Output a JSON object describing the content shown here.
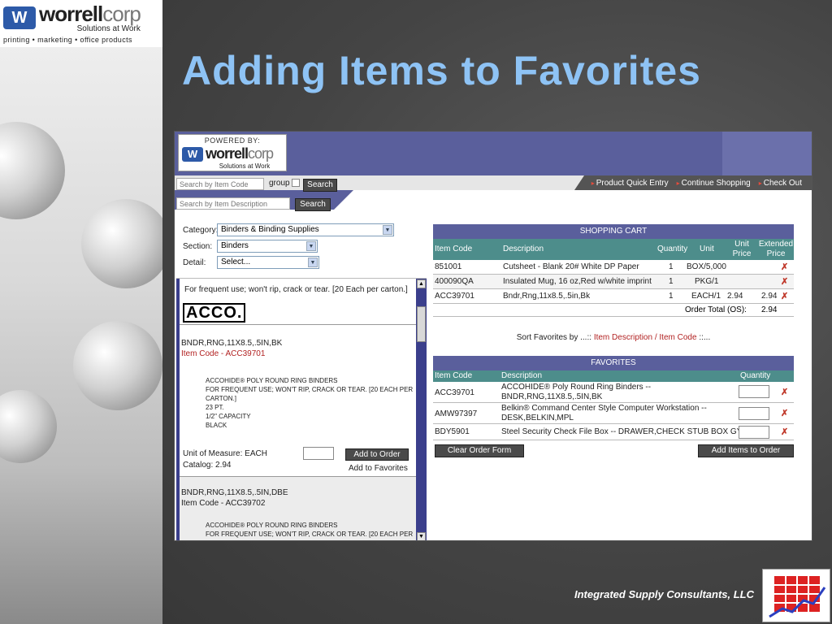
{
  "slide": {
    "logo": {
      "word1": "worrell",
      "word2": "corp",
      "sub": "Solutions at Work",
      "mark": "W"
    },
    "tagline": "printing • marketing • office products",
    "title": "Adding Items to Favorites",
    "footer": "Integrated Supply Consultants, LLC"
  },
  "app": {
    "powered_by": "POWERED BY:",
    "brand_word1": "worrell",
    "brand_word2": "corp",
    "brand_sub": "Solutions at Work",
    "brand_mark": "W",
    "nav": [
      "Product Quick Entry",
      "Continue Shopping",
      "Check Out"
    ],
    "search": {
      "item_code_placeholder": "Search by Item Code",
      "group_label": "group",
      "search_button": "Search",
      "description_placeholder": "Search by Item Description"
    },
    "filters": {
      "category_label": "Category:",
      "category_value": "Binders & Binding Supplies",
      "section_label": "Section:",
      "section_value": "Binders",
      "detail_label": "Detail:",
      "detail_value": "Select..."
    },
    "products": {
      "top_description": "For frequent use; won't rip, crack or tear. [20 Each per carton.]",
      "brand_logo": "ACCO.",
      "items": [
        {
          "name": "BNDR,RNG,11X8.5,.5IN,BK",
          "code": "Item Code - ACC39701",
          "details": [
            "ACCOHIDE® POLY ROUND RING BINDERS",
            "FOR FREQUENT USE; WON'T RIP, CRACK OR TEAR. [20 EACH PER CARTON.]",
            "23 PT.",
            "1/2\" CAPACITY",
            "BLACK"
          ],
          "uom": "Unit of Measure: EACH",
          "catalog": "Catalog: 2.94",
          "add_order": "Add to Order",
          "add_favorites": "Add to Favorites"
        },
        {
          "name": "BNDR,RNG,11X8.5,.5IN,DBE",
          "code": "Item Code - ACC39702",
          "details": [
            "ACCOHIDE® POLY ROUND RING BINDERS",
            "FOR FREQUENT USE; WON'T RIP, CRACK OR TEAR. [20 EACH PER"
          ]
        }
      ]
    },
    "cart": {
      "title": "SHOPPING CART",
      "headers": {
        "code": "Item Code",
        "desc": "Description",
        "qty": "Quantity",
        "unit": "Unit",
        "unit_price": "Unit Price",
        "ext_price": "Extended Price"
      },
      "rows": [
        {
          "code": "851001",
          "desc": "Cutsheet - Blank 20# White DP Paper",
          "qty": "1",
          "unit": "BOX/5,000",
          "unit_price": "",
          "ext_price": ""
        },
        {
          "code": "400090QA",
          "desc": "Insulated Mug, 16 oz,Red w/white imprint",
          "qty": "1",
          "unit": "PKG/1",
          "unit_price": "",
          "ext_price": ""
        },
        {
          "code": "ACC39701",
          "desc": "Bndr,Rng,11x8.5,.5in,Bk",
          "qty": "1",
          "unit": "EACH/1",
          "unit_price": "2.94",
          "ext_price": "2.94"
        }
      ],
      "order_total_label": "Order Total (OS):",
      "order_total_value": "2.94"
    },
    "sort": {
      "prefix": "Sort Favorites by ...::",
      "option1": "Item Description",
      "sep": "/",
      "option2": "Item Code",
      "suffix": "::..."
    },
    "favorites": {
      "title": "FAVORITES",
      "headers": {
        "code": "Item Code",
        "desc": "Description",
        "qty": "Quantity"
      },
      "rows": [
        {
          "code": "ACC39701",
          "desc1": "ACCOHIDE® Poly Round Ring Binders --",
          "desc2": "BNDR,RNG,11X8.5,.5IN,BK"
        },
        {
          "code": "AMW97397",
          "desc1": "Belkin® Command Center Style Computer Workstation --",
          "desc2": "DESK,BELKIN,MPL"
        },
        {
          "code": "BDY5901",
          "desc1": "Steel Security Check File Box -- DRAWER,CHECK STUB BOX GY",
          "desc2": ""
        }
      ],
      "clear_button": "Clear Order Form",
      "add_button": "Add Items to Order"
    },
    "colors": {
      "header_purple": "#5a5f9c",
      "teal": "#4d8d8b",
      "code_red": "#b22222"
    }
  }
}
